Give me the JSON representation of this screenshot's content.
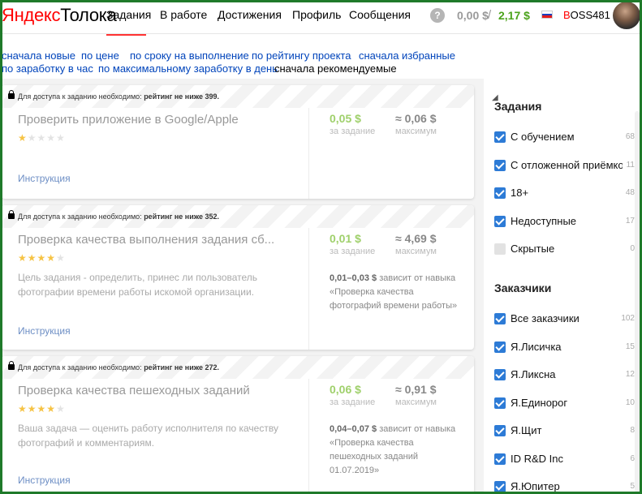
{
  "header": {
    "logo_main": "Яндекс",
    "logo_sub": "Толока",
    "nav": [
      {
        "label": "Задания",
        "active": true
      },
      {
        "label": "В работе"
      },
      {
        "label": "Достижения"
      },
      {
        "label": "Профиль"
      },
      {
        "label": "Сообщения"
      }
    ],
    "help": "?",
    "balance_pending": "0,00 $",
    "balance_sep": "/",
    "balance_available": "2,17 $",
    "username_first": "B",
    "username_rest": "OSS481"
  },
  "sort": {
    "options": [
      "сначала новые",
      "по цене",
      "по сроку на выполнение",
      "по рейтингу проекта",
      "сначала избранные",
      "по заработку в час",
      "по максимальному заработку в день",
      "сначала рекомендуемые"
    ],
    "active": "сначала рекомендуемые"
  },
  "tasks": [
    {
      "access_prefix": "Для доступа к заданию необходимо:",
      "access_req": "рейтинг не ниже 399.",
      "title": "Проверить приложение в Google/Apple",
      "rating": 1,
      "description": "",
      "price": "0,05 $",
      "price_caption": "за задание",
      "max": "≈ 0,06 $",
      "max_caption": "максимум",
      "range_value": "",
      "range_text": "",
      "link": "Инструкция"
    },
    {
      "access_prefix": "Для доступа к заданию необходимо:",
      "access_req": "рейтинг не ниже 352.",
      "title": "Проверка качества выполнения задания сб...",
      "rating": 4,
      "description": "Цель задания - определить, принес ли пользователь фотографии времени работы искомой организации.",
      "price": "0,01 $",
      "price_caption": "за задание",
      "max": "≈ 4,69 $",
      "max_caption": "максимум",
      "range_value": "0,01–0,03 $",
      "range_text": "зависит от навыка «Проверка качества фотографий времени работы»",
      "link": "Инструкция"
    },
    {
      "access_prefix": "Для доступа к заданию необходимо:",
      "access_req": "рейтинг не ниже 272.",
      "title": "Проверка качества пешеходных заданий",
      "rating": 4,
      "description": "Ваша задача — оценить работу исполнителя по качеству фотографий и комментариям.",
      "price": "0,06 $",
      "price_caption": "за задание",
      "max": "≈ 0,91 $",
      "max_caption": "максимум",
      "range_value": "0,04–0,07 $",
      "range_text": "зависит от навыка «Проверка качества пешеходных заданий 01.07.2019»",
      "link": "Инструкция"
    }
  ],
  "sidebar": {
    "tasks_heading": "Задания",
    "task_filters": [
      {
        "label": "С обучением",
        "count": "68",
        "checked": true
      },
      {
        "label": "С отложенной приёмкой",
        "count": "11",
        "checked": true
      },
      {
        "label": "18+",
        "count": "48",
        "checked": true
      },
      {
        "label": "Недоступные",
        "count": "17",
        "checked": true
      },
      {
        "label": "Скрытые",
        "count": "0",
        "checked": false
      }
    ],
    "customers_heading": "Заказчики",
    "customer_filters": [
      {
        "label": "Все заказчики",
        "count": "102",
        "checked": true
      },
      {
        "label": "Я.Лисичка",
        "count": "15",
        "checked": true
      },
      {
        "label": "Я.Ликсна",
        "count": "12",
        "checked": true
      },
      {
        "label": "Я.Единорог",
        "count": "10",
        "checked": true
      },
      {
        "label": "Я.Щит",
        "count": "8",
        "checked": true
      },
      {
        "label": "ID R&D Inc",
        "count": "6",
        "checked": true
      },
      {
        "label": "Я.Юпитер",
        "count": "5",
        "checked": true
      }
    ]
  },
  "colors": {
    "frame": "#1f7a2a",
    "accent_red": "#ff0000",
    "balance_green": "#4ba31b",
    "checkbox_blue": "#2d7bd6",
    "link_blue": "#0044bb"
  }
}
